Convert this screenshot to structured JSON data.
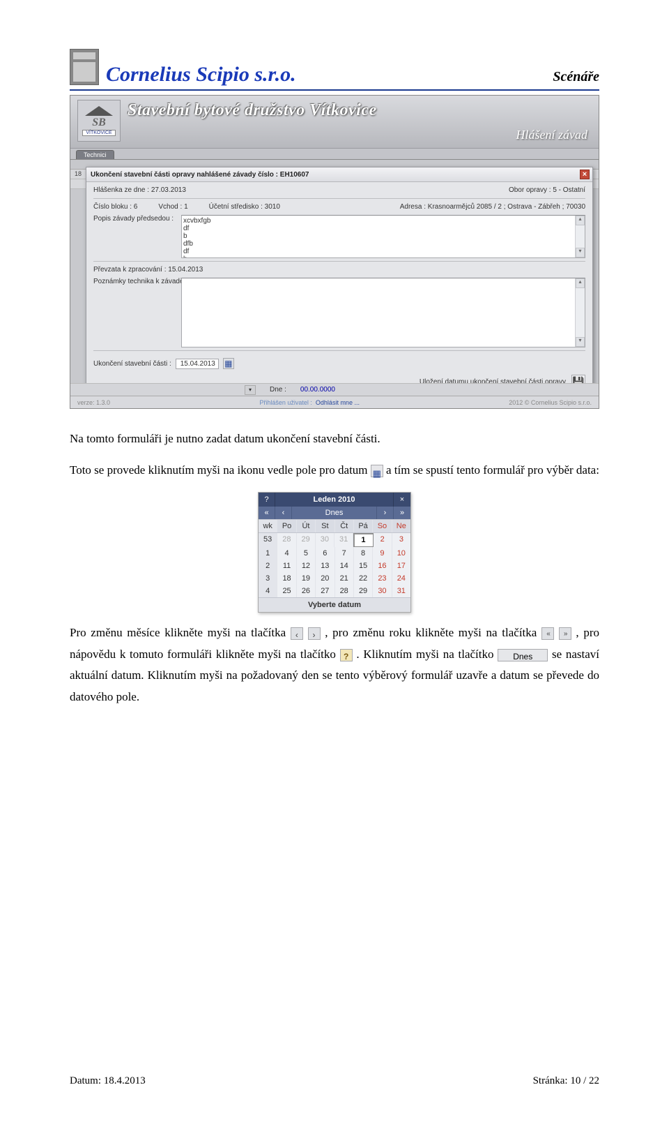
{
  "header": {
    "company": "Cornelius Scipio s.r.o.",
    "doc_type": "Scénáře"
  },
  "app": {
    "banner_title": "Stavební bytové družstvo Vítkovice",
    "banner_subtitle": "Hlášení závad",
    "tab": "Technici",
    "back_cell_left": "18",
    "logo_vit": "VÍTKOVICE",
    "bottom_dne_label": "Dne :",
    "bottom_dne_value": "00.00.0000",
    "footer_left": "verze: 1.3.0",
    "footer_mid_a": "Přihlášen uživatel :",
    "footer_mid_b": "Odhlásit mne ...",
    "footer_right": "2012 © Cornelius Scipio s.r.o."
  },
  "dialog": {
    "title": "Ukončení stavební části opravy nahlášené závady číslo : EH10607",
    "hlasenka": "Hlášenka ze dne : 27.03.2013",
    "obor": "Obor opravy : 5 - Ostatní",
    "blok": "Číslo bloku : 6",
    "vchod": "Vchod : 1",
    "stredisko": "Účetní středisko : 3010",
    "adresa": "Adresa : Krasnoarmějců 2085 / 2 ; Ostrava - Zábřeh ; 70030",
    "popis_label": "Popis závady předsedou :",
    "popis_content": "xcvbxfgb\ndf\nb\ndfb\ndf\nb\ndfb\ndf",
    "prevzata": "Převzata k zpracování : 15.04.2013",
    "pozn_label": "Poznámky technika k závadě :",
    "uk_label": "Ukončení stavební části :",
    "uk_value": "15.04.2013",
    "save_label": "Uložení datumu  ukončení stavební části  opravy"
  },
  "paragraphs": {
    "p1": "Na tomto formuláři je nutno zadat datum ukončení stavební části.",
    "p2a": "Toto se provede kliknutím myši na ikonu vedle pole pro datum ",
    "p2b": " a tím se spustí tento formulář pro výběr data:",
    "p3a": "Pro změnu měsíce klikněte myši na tlačítka ",
    "p3b": ", pro změnu roku klikněte myši na tlačítka ",
    "p3c": ", pro nápovědu k tomuto formuláři klikněte myši na tlačítko ",
    "p3d": ". Kliknutím myši na tlačítko ",
    "p3e": " se nastaví aktuální datum. Kliknutím myši na požadovaný den se tento výběrový formulář uzavře a datum se převede do datového pole.",
    "dnes": "Dnes"
  },
  "datepicker": {
    "title": "Leden 2010",
    "q": "?",
    "x": "×",
    "laquo": "«",
    "lsaquo": "‹",
    "rsaquo": "›",
    "raquo": "»",
    "today": "Dnes",
    "wk": "wk",
    "days": [
      "Po",
      "Út",
      "St",
      "Čt",
      "Pá",
      "So",
      "Ne"
    ],
    "rows": [
      {
        "wk": "53",
        "cells": [
          {
            "v": "28",
            "cls": "muted"
          },
          {
            "v": "29",
            "cls": "muted"
          },
          {
            "v": "30",
            "cls": "muted"
          },
          {
            "v": "31",
            "cls": "muted"
          },
          {
            "v": "1",
            "cls": "sel"
          },
          {
            "v": "2",
            "cls": "red"
          },
          {
            "v": "3",
            "cls": "red"
          }
        ]
      },
      {
        "wk": "1",
        "cells": [
          {
            "v": "4"
          },
          {
            "v": "5"
          },
          {
            "v": "6"
          },
          {
            "v": "7"
          },
          {
            "v": "8"
          },
          {
            "v": "9",
            "cls": "red"
          },
          {
            "v": "10",
            "cls": "red"
          }
        ]
      },
      {
        "wk": "2",
        "cells": [
          {
            "v": "11"
          },
          {
            "v": "12"
          },
          {
            "v": "13"
          },
          {
            "v": "14"
          },
          {
            "v": "15"
          },
          {
            "v": "16",
            "cls": "red"
          },
          {
            "v": "17",
            "cls": "red"
          }
        ]
      },
      {
        "wk": "3",
        "cells": [
          {
            "v": "18"
          },
          {
            "v": "19"
          },
          {
            "v": "20"
          },
          {
            "v": "21"
          },
          {
            "v": "22"
          },
          {
            "v": "23",
            "cls": "red"
          },
          {
            "v": "24",
            "cls": "red"
          }
        ]
      },
      {
        "wk": "4",
        "cells": [
          {
            "v": "25"
          },
          {
            "v": "26"
          },
          {
            "v": "27"
          },
          {
            "v": "28"
          },
          {
            "v": "29"
          },
          {
            "v": "30",
            "cls": "red"
          },
          {
            "v": "31",
            "cls": "red"
          }
        ]
      }
    ],
    "footer": "Vyberte datum"
  },
  "footer": {
    "date": "Datum: 18.4.2013",
    "page": "Stránka: 10 / 22"
  }
}
